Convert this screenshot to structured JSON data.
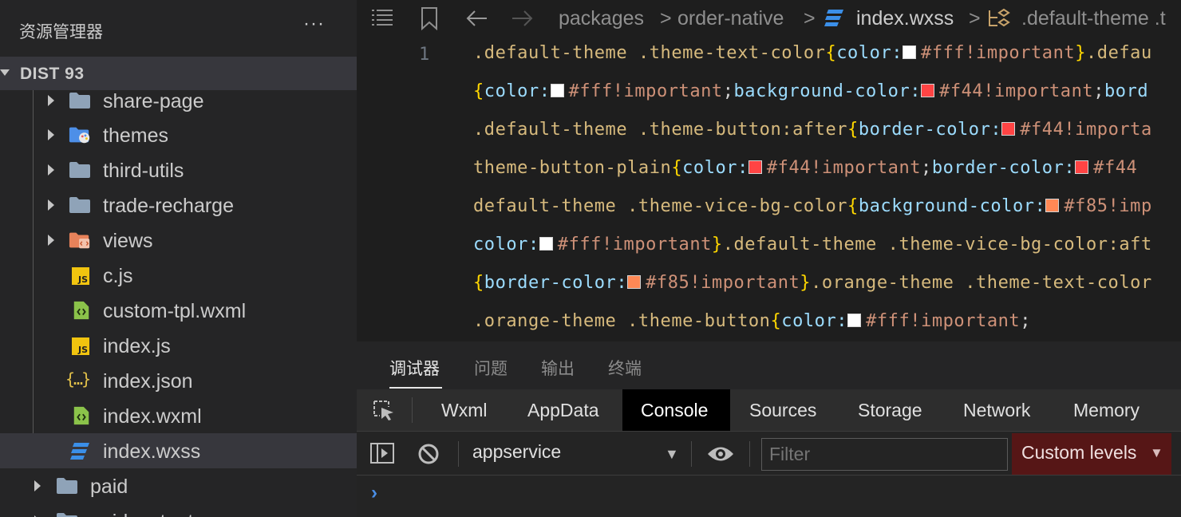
{
  "sidebar": {
    "title": "资源管理器",
    "more": "···",
    "section": "DIST 93",
    "items": [
      {
        "label": "share-page"
      },
      {
        "label": "themes"
      },
      {
        "label": "third-utils"
      },
      {
        "label": "trade-recharge"
      },
      {
        "label": "views"
      },
      {
        "label": "c.js"
      },
      {
        "label": "custom-tpl.wxml"
      },
      {
        "label": "index.js"
      },
      {
        "label": "index.json"
      },
      {
        "label": "index.wxml"
      },
      {
        "label": "index.wxss"
      },
      {
        "label": "paid"
      },
      {
        "label": "paidcontent"
      }
    ],
    "json_icon_text": "{…}",
    "js_icon_text": "JS"
  },
  "editor": {
    "breadcrumb": [
      "packages",
      "order-native",
      "index.wxss",
      ".default-theme .t"
    ],
    "line_number": "1",
    "code_lines": [
      [
        ".default-theme ",
        ".theme-text-color",
        "{",
        "color:",
        "#fff",
        "!important",
        "}",
        ".defau"
      ],
      [
        "{",
        "color:",
        "#fff",
        "!important",
        ";",
        "background-color:",
        "#f44",
        "!important",
        ";",
        "bord"
      ],
      [
        ".default-theme ",
        ".theme-button",
        ":after",
        "{",
        "border-color:",
        "#f44",
        "!importa"
      ],
      [
        "theme-button-plain",
        "{",
        "color:",
        "#f44",
        "!important",
        ";",
        "border-color:",
        "#f44"
      ],
      [
        "default-theme ",
        ".theme-vice-bg-color",
        "{",
        "background-color:",
        "#f85",
        "!imp"
      ],
      [
        "color:",
        "#fff",
        "!important",
        "}",
        ".default-theme ",
        ".theme-vice-bg-color",
        ":aft"
      ],
      [
        "{",
        "border-color:",
        "#f85",
        "!important",
        "}",
        ".orange-theme ",
        ".theme-text-color"
      ],
      [
        ".orange-theme ",
        ".theme-button",
        "{",
        "color:",
        "#fff",
        "!important",
        ";"
      ]
    ],
    "swatch_colors": {
      "fff": "#ffffff",
      "f44": "#ff4444",
      "f85": "#ff8855"
    }
  },
  "panel": {
    "tabs": [
      "调试器",
      "问题",
      "输出",
      "终端"
    ],
    "devtools_tabs": [
      "Wxml",
      "AppData",
      "Console",
      "Sources",
      "Storage",
      "Network",
      "Memory"
    ],
    "active_devtools_tab": "Console",
    "context": "appservice",
    "filter_placeholder": "Filter",
    "levels": "Custom levels",
    "prompt": "›"
  },
  "colors": {
    "folder": "#8fa3b8",
    "themes_folder": "#4d8fe8",
    "views_folder": "#e8825a",
    "wxml_icon": "#8bc34a",
    "wxss_icon": "#3b8fe8",
    "js_icon": "#f1c40f"
  }
}
